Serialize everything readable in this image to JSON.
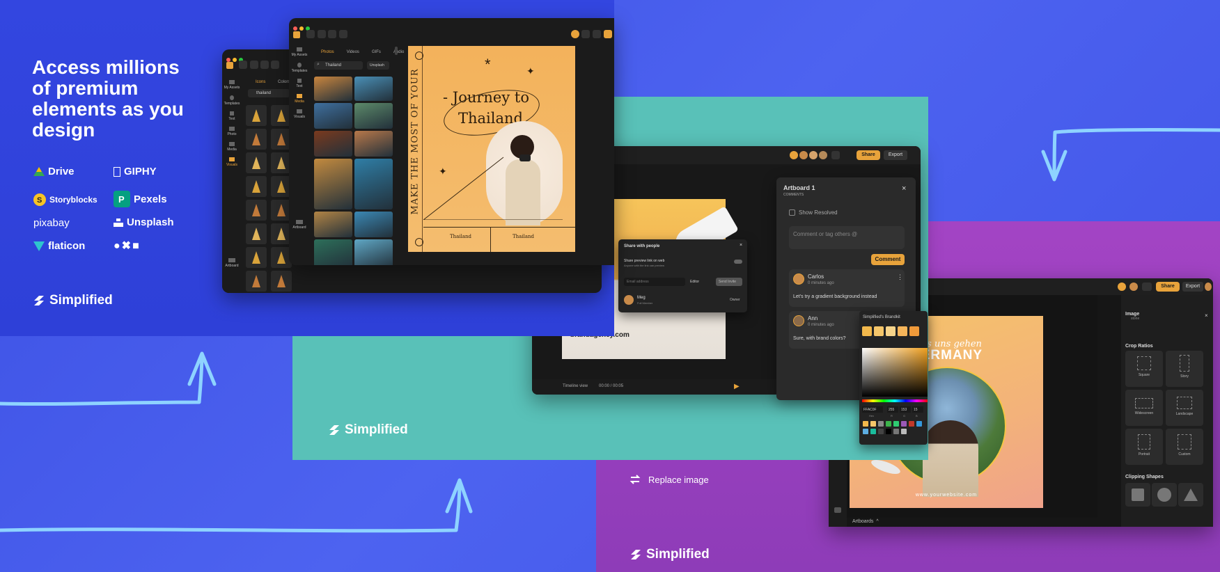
{
  "panel1": {
    "headline": "Access millions of premium elements as you design",
    "brands": [
      {
        "name": "Drive",
        "icon": "drive-icon"
      },
      {
        "name": "GIPHY",
        "icon": "giphy-icon"
      },
      {
        "name": "Storyblocks",
        "icon": "storyblocks-icon"
      },
      {
        "name": "Pexels",
        "icon": "pexels-icon"
      },
      {
        "name": "pixabay",
        "icon": "pixabay-icon"
      },
      {
        "name": "Unsplash",
        "icon": "unsplash-icon"
      },
      {
        "name": "flaticon",
        "icon": "flaticon-icon"
      },
      {
        "name": "●✖■",
        "icon": "shapes-icon"
      }
    ],
    "logo": "Simplified",
    "back_window": {
      "sidebar": [
        "My Assets",
        "Templates",
        "Text",
        "Photo",
        "Media",
        "Visuals",
        "Artboard"
      ],
      "tabs": [
        "Icons",
        "Colors"
      ],
      "search_value": "thailand"
    },
    "front_window": {
      "sidebar": [
        "My Assets",
        "Templates",
        "Text",
        "Media",
        "Visuals",
        "Artboard"
      ],
      "tabs": [
        "Photos",
        "Videos",
        "GIFs",
        "Audio"
      ],
      "search_value": "Thailand",
      "source": "Unsplash",
      "design": {
        "title_line1": "- Journey to",
        "title_line2": "Thailand",
        "vertical_text": "MAKE THE MOST OF YOUR",
        "footer_left": "Thailand",
        "footer_right": "Thailand"
      }
    }
  },
  "panel_teal": {
    "logo": "Simplified",
    "toolbar": {
      "share": "Share",
      "export": "Export"
    },
    "share_dialog": {
      "title": "Share with people",
      "preview_label": "Share preview link on web",
      "preview_sub": "Anyone with the link can preview",
      "email_placeholder": "Email address",
      "role": "Editor",
      "send": "Send Invite",
      "member_name": "Meg",
      "member_sub": "Full Member",
      "member_role": "Owner"
    },
    "canvas_text": "brandagency.com",
    "timeline": {
      "label": "Timeline view",
      "time": "00:00 / 00:05"
    },
    "comments": {
      "title": "Artboard 1",
      "subtitle": "COMMENTS",
      "show_resolved": "Show Resolved",
      "placeholder": "Comment or tag others @",
      "button": "Comment",
      "items": [
        {
          "name": "Carlos",
          "time": "0 minutes ago",
          "text": "Let's try a gradient background instead"
        },
        {
          "name": "Ann",
          "time": "0 minutes ago",
          "text": "Sure, with brand colors?"
        }
      ]
    },
    "brandkit": {
      "title": "Simplified's Brandkit",
      "colors": [
        "#f2b84c",
        "#f5c66a",
        "#f7d48a",
        "#f6b55a",
        "#f09a3a"
      ],
      "hex": "FFAC0F",
      "rgb": [
        "255",
        "153",
        "15"
      ],
      "hex_label": "Hex",
      "rgb_labels": [
        "R",
        "G",
        "B"
      ],
      "palette": [
        "#f2b84c",
        "#f5c66a",
        "#8a8a8a",
        "#3cb44b",
        "#2ecc71",
        "#9b59b6",
        "#c0392b",
        "#3498db",
        "#5dade2",
        "#1abc9c",
        "#444444",
        "#000000",
        "#777777",
        "#bbbbbb"
      ]
    }
  },
  "panel_purple": {
    "logo": "Simplified",
    "replace_image": "Replace image",
    "toolbar": {
      "share": "Share",
      "export": "Export"
    },
    "design": {
      "script_text": "Lass uns gehen",
      "title": "GERMANY",
      "footer": "www.yourwebsite.com"
    },
    "artboards_label": "Artboards",
    "right_panel": {
      "title": "Image",
      "subtitle": "stone",
      "crop_title": "Crop Ratios",
      "crops": [
        {
          "label": "Square",
          "ratio": "1:1"
        },
        {
          "label": "Story",
          "ratio": "9:16"
        },
        {
          "label": "Widescreen",
          "ratio": "16:9"
        },
        {
          "label": "Landscape",
          "ratio": "4:3"
        },
        {
          "label": "Portrait",
          "ratio": "3:4"
        },
        {
          "label": "Custom",
          "ratio": ""
        }
      ],
      "clip_title": "Clipping Shapes"
    }
  },
  "colors": {
    "blue": "#3b4fe3",
    "teal": "#59c1b8",
    "purple": "#a344c4",
    "accent": "#e8a33b",
    "arrow": "#8ed3ff"
  }
}
